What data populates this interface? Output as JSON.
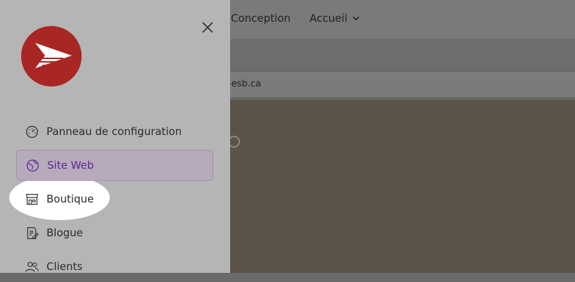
{
  "background": {
    "nav": {
      "conception_label": "Conception",
      "accueil_label": "Accueil"
    },
    "url_text": "e-esb.ca"
  },
  "drawer": {
    "menu": [
      {
        "label": "Panneau de configuration",
        "icon": "gauge-icon",
        "active": false
      },
      {
        "label": "Site Web",
        "icon": "globe-icon",
        "active": true
      },
      {
        "label": "Boutique",
        "icon": "storefront-icon",
        "active": false
      },
      {
        "label": "Blogue",
        "icon": "edit-document-icon",
        "active": false
      },
      {
        "label": "Clients",
        "icon": "users-icon",
        "active": false
      }
    ]
  },
  "colors": {
    "brand_red": "#a82623",
    "active_text": "#5a2a8a",
    "active_bg": "#b8aabd"
  }
}
